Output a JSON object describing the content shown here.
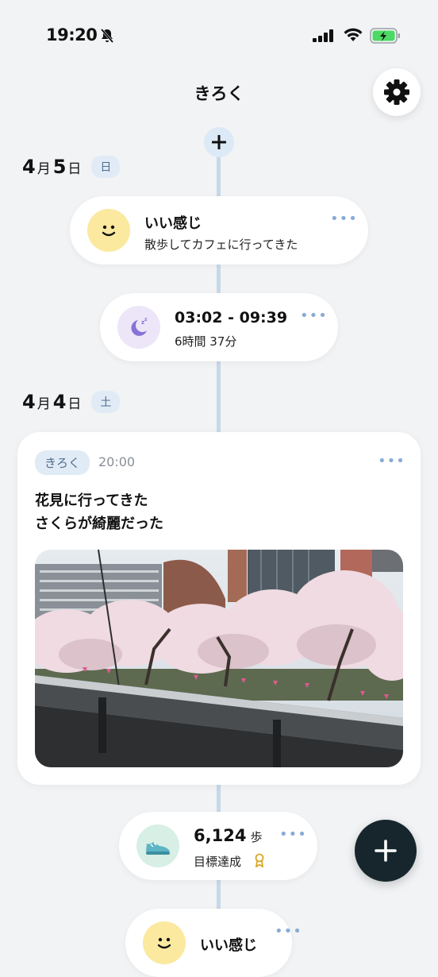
{
  "status_bar": {
    "time": "19:20"
  },
  "header": {
    "title": "きろく"
  },
  "days": [
    {
      "month": "4",
      "month_suffix": "月",
      "day": "5",
      "day_suffix": "日",
      "weekday": "日",
      "entries": [
        {
          "type": "mood",
          "title": "いい感じ",
          "text": "散歩してカフェに行ってきた",
          "icon": "smile-face-icon"
        },
        {
          "type": "sleep",
          "title": "03:02 - 09:39",
          "text": "6時間 37分",
          "icon": "sleep-moon-icon"
        }
      ]
    },
    {
      "month": "4",
      "month_suffix": "月",
      "day": "4",
      "day_suffix": "日",
      "weekday": "土",
      "entries": [
        {
          "type": "note",
          "tag": "きろく",
          "time": "20:00",
          "text_line1": "花見に行ってきた",
          "text_line2": "さくらが綺麗だった",
          "photo": "cherry-blossom-photo"
        },
        {
          "type": "steps",
          "value": "6,124",
          "unit": "歩",
          "text": "目標達成",
          "icon": "sneaker-icon"
        },
        {
          "type": "mood",
          "title": "いい感じ",
          "icon": "smile-face-icon"
        }
      ]
    }
  ],
  "more_label": "•••",
  "colors": {
    "accent": "#88acd4",
    "mood_bg": "#fbe9a0",
    "sleep_bg": "#ece6f8",
    "steps_bg": "#d7efe5",
    "fab": "#17262d"
  }
}
